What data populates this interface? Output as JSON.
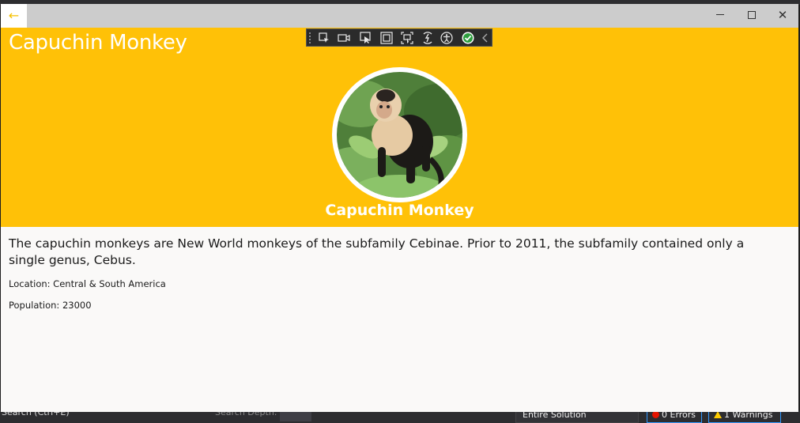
{
  "window": {
    "back_icon": "←",
    "controls": {
      "minimize": "minimize-icon",
      "maximize": "maximize-icon",
      "close": "✕"
    }
  },
  "header": {
    "title": "Capuchin Monkey",
    "name": "Capuchin Monkey",
    "background_color": "#FFC107"
  },
  "details": {
    "description": "The capuchin monkeys are New World monkeys of the subfamily Cebinae. Prior to 2011, the subfamily contained only a single genus, Cebus.",
    "location": "Location: Central & South America",
    "population": "Population: 23000"
  },
  "debug_toolbar": {
    "icons": [
      "select-element-icon",
      "record-icon",
      "select-tool-icon",
      "layout-adorner-icon",
      "track-focus-icon",
      "hot-reload-icon",
      "accessibility-icon",
      "status-ok-icon",
      "collapse-chevron-icon"
    ]
  },
  "ide_background": {
    "search": "Search (Ctrl+E)",
    "search_depth": "Search Depth:",
    "scope": "Entire Solution",
    "errors": "0 Errors",
    "warnings": "1 Warnings"
  }
}
